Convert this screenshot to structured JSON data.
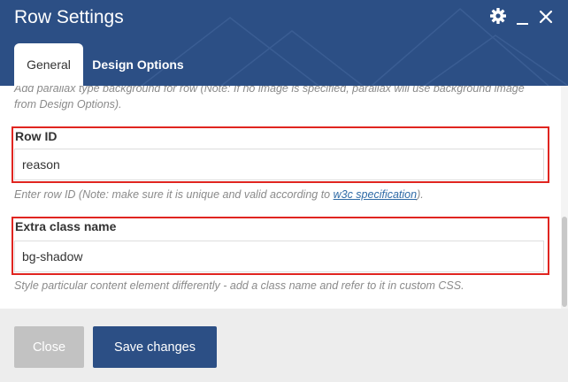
{
  "window": {
    "title": "Row Settings"
  },
  "tabs": [
    {
      "label": "General"
    },
    {
      "label": "Design Options"
    }
  ],
  "content": {
    "parallax_help": "Add parallax type background for row (Note: If no image is specified, parallax will use background image from Design Options).",
    "row_id": {
      "label": "Row ID",
      "value": "reason",
      "help_prefix": "Enter row ID (Note: make sure it is unique and valid according to ",
      "help_link": "w3c specification",
      "help_suffix": ")."
    },
    "extra_class": {
      "label": "Extra class name",
      "value": "bg-shadow",
      "help": "Style particular content element differently - add a class name and refer to it in custom CSS."
    }
  },
  "footer": {
    "close_label": "Close",
    "save_label": "Save changes"
  },
  "colors": {
    "header": "#2c4f85",
    "highlight_border": "#e02520",
    "save_button": "#2c4f85",
    "close_button": "#c2c2c2"
  },
  "icons": {
    "settings": "gear-icon",
    "minimize": "minimize-icon",
    "close": "close-icon"
  }
}
